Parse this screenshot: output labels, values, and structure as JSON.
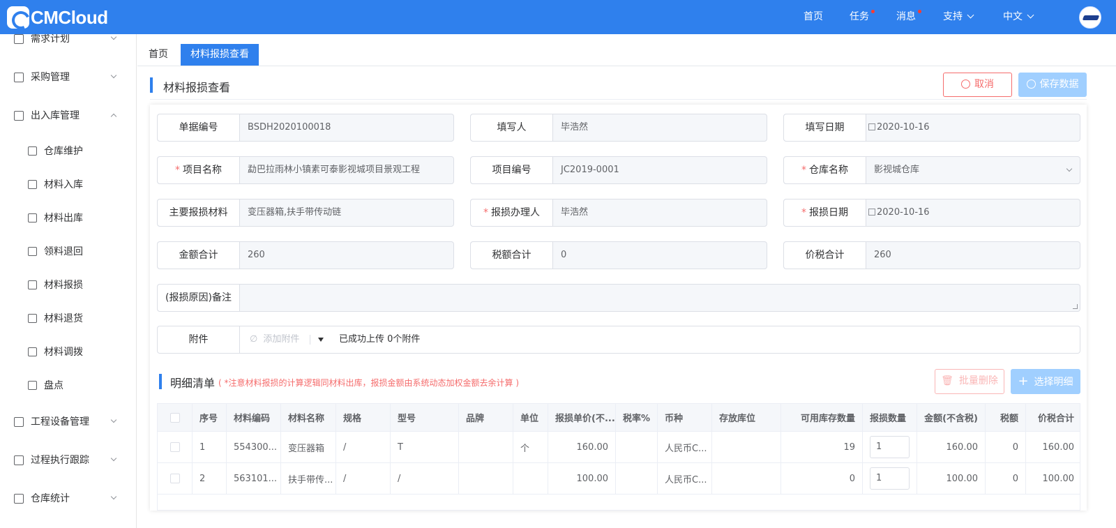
{
  "app": {
    "logo_text": "CMCloud"
  },
  "topnav": {
    "home": "首页",
    "tasks": "任务",
    "messages": "消息",
    "support": "支持",
    "language": "中文"
  },
  "sidebar": {
    "items": [
      {
        "label": "需求计划"
      },
      {
        "label": "采购管理"
      },
      {
        "label": "出入库管理"
      },
      {
        "label": "工程设备管理"
      },
      {
        "label": "过程执行跟踪"
      },
      {
        "label": "仓库统计"
      }
    ],
    "subitems": [
      {
        "label": "仓库维护"
      },
      {
        "label": "材料入库"
      },
      {
        "label": "材料出库"
      },
      {
        "label": "领料退回"
      },
      {
        "label": "材料报损"
      },
      {
        "label": "材料退货"
      },
      {
        "label": "材料调拨"
      },
      {
        "label": "盘点"
      }
    ]
  },
  "tabs": [
    {
      "label": "首页"
    },
    {
      "label": "材料报损查看"
    }
  ],
  "page": {
    "title": "材料报损查看",
    "cancel_label": "取消",
    "save_label": "保存数据"
  },
  "form": {
    "doc_no": {
      "label": "单据编号",
      "value": "BSDH2020100018"
    },
    "writer": {
      "label": "填写人",
      "value": "毕浩然"
    },
    "write_date": {
      "label": "填写日期",
      "value": "2020-10-16"
    },
    "project_name": {
      "label": "项目名称",
      "value": "勐巴拉雨林小镇素可泰影视城项目景观工程"
    },
    "project_no": {
      "label": "项目编号",
      "value": "JC2019-0001"
    },
    "warehouse": {
      "label": "仓库名称",
      "value": "影视城仓库"
    },
    "main_material": {
      "label": "主要报损材料",
      "value": "变压器箱,扶手带传动链"
    },
    "handler": {
      "label": "报损办理人",
      "value": "毕浩然"
    },
    "loss_date": {
      "label": "报损日期",
      "value": "2020-10-16"
    },
    "amount_total": {
      "label": "金额合计",
      "value": "260"
    },
    "tax_total": {
      "label": "税额合计",
      "value": "0"
    },
    "price_tax_total": {
      "label": "价税合计",
      "value": "260"
    },
    "remark": {
      "label": "(报损原因)备注",
      "value": ""
    },
    "attachment": {
      "label": "附件",
      "add_label": "添加附件",
      "status": "已成功上传 0个附件"
    }
  },
  "detail": {
    "title": "明细清单",
    "note": "( *注意材料报损的计算逻辑同材料出库，报损金额由系统动态加权金额去余计算 )",
    "batch_delete_label": "批量删除",
    "choose_label": "选择明细",
    "columns": [
      "序号",
      "材料编码",
      "材料名称",
      "规格",
      "型号",
      "品牌",
      "单位",
      "报损单价(不...",
      "税率%",
      "币种",
      "存放库位",
      "可用库存数量",
      "报损数量",
      "金额(不含税)",
      "税额",
      "价税合计"
    ],
    "rows": [
      {
        "seq": "1",
        "code": "554300...",
        "name": "变压器箱",
        "spec": "/",
        "model": "T",
        "brand": "",
        "unit": "个",
        "price": "160.00",
        "tax_rate": "",
        "currency": "人民币C...",
        "location": "",
        "stock": "19",
        "qty": "1",
        "amount": "160.00",
        "tax": "0",
        "total": "160.00"
      },
      {
        "seq": "2",
        "code": "563101...",
        "name": "扶手带传...",
        "spec": "/",
        "model": "/",
        "brand": "",
        "unit": "",
        "price": "100.00",
        "tax_rate": "",
        "currency": "人民币C...",
        "location": "",
        "stock": "0",
        "qty": "1",
        "amount": "100.00",
        "tax": "0",
        "total": "100.00"
      }
    ]
  },
  "colors": {
    "primary": "#2f80ed",
    "danger": "#f56c6c",
    "disabled_primary": "#a0cfff"
  }
}
